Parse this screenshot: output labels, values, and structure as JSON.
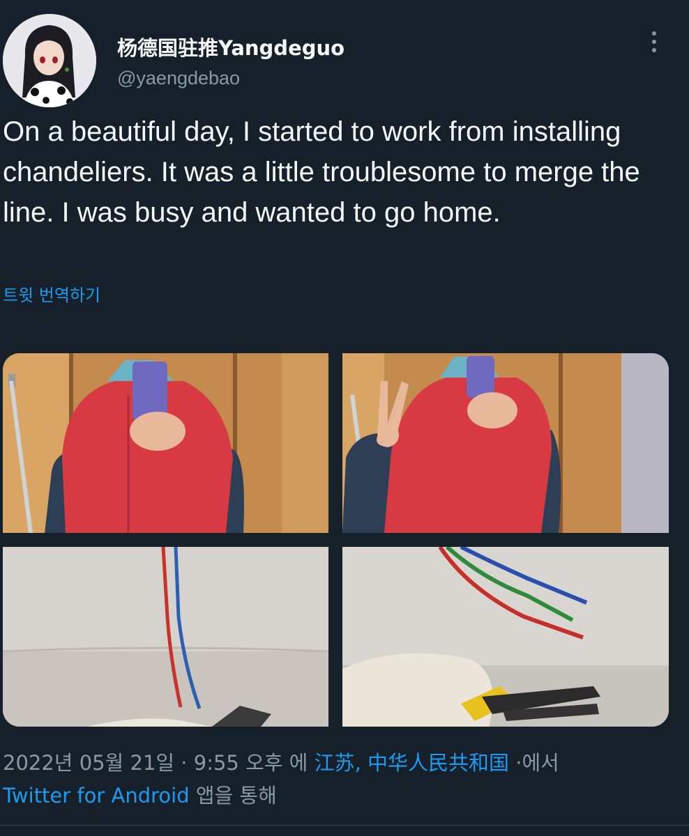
{
  "user": {
    "display_name": "杨德国驻推Yangdeguo",
    "handle": "@yaengdebao"
  },
  "tweet": {
    "text": "On a beautiful day, I started to work from installing chandeliers. It was a little troublesome to merge the line. I was busy and wanted to go home.",
    "translate_label": "트윗 번역하기"
  },
  "meta": {
    "date": "2022년 05월 21일",
    "sep1": " · ",
    "time": "9:55 오후",
    "location_prefix": " 에 ",
    "location": "江苏, 中华人民共和国",
    "location_suffix": " ·에서",
    "source": "Twitter for Android",
    "source_suffix": " 앱을 통해"
  },
  "media": {
    "photos": [
      "mirror-selfie-photo",
      "peace-sign-selfie-photo",
      "red-blue-wires-photo",
      "three-wires-pliers-photo"
    ]
  },
  "icons": {
    "more": "more-options-icon"
  },
  "colors": {
    "background": "#15202b",
    "link": "#1d9bf0",
    "muted": "#8b98a5",
    "text": "#f7f9f9"
  }
}
